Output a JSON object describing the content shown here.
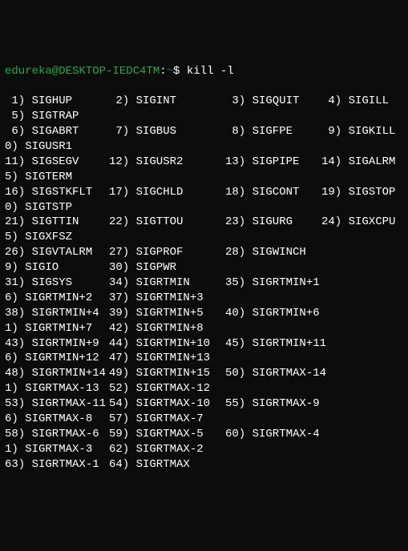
{
  "prompt": {
    "user_host": "edureka@DESKTOP-IEDC4TM",
    "path": "~",
    "cmd_symbol": "$ ",
    "command": "kill -l"
  },
  "signals": {
    "s1": {
      "n": " 1)",
      "name": "SIGHUP"
    },
    "s2": {
      "n": " 2)",
      "name": "SIGINT"
    },
    "s3": {
      "n": " 3)",
      "name": "SIGQUIT"
    },
    "s4": {
      "n": " 4)",
      "name": "SIGILL"
    },
    "s5": {
      "n": " 5)",
      "name": "SIGTRAP"
    },
    "s6": {
      "n": " 6)",
      "name": "SIGABRT"
    },
    "s7": {
      "n": " 7)",
      "name": "SIGBUS"
    },
    "s8": {
      "n": " 8)",
      "name": "SIGFPE"
    },
    "s9": {
      "n": " 9)",
      "name": "SIGKILL"
    },
    "s10": {
      "n": "0)",
      "name": "SIGUSR1"
    },
    "s11": {
      "n": "11)",
      "name": "SIGSEGV"
    },
    "s12": {
      "n": "12)",
      "name": "SIGUSR2"
    },
    "s13": {
      "n": "13)",
      "name": "SIGPIPE"
    },
    "s14": {
      "n": "14)",
      "name": "SIGALRM"
    },
    "s15": {
      "n": "5)",
      "name": "SIGTERM"
    },
    "s16": {
      "n": "16)",
      "name": "SIGSTKFLT"
    },
    "s17": {
      "n": "17)",
      "name": "SIGCHLD"
    },
    "s18": {
      "n": "18)",
      "name": "SIGCONT"
    },
    "s19": {
      "n": "19)",
      "name": "SIGSTOP"
    },
    "s20": {
      "n": "0)",
      "name": "SIGTSTP"
    },
    "s21": {
      "n": "21)",
      "name": "SIGTTIN"
    },
    "s22": {
      "n": "22)",
      "name": "SIGTTOU"
    },
    "s23": {
      "n": "23)",
      "name": "SIGURG"
    },
    "s24": {
      "n": "24)",
      "name": "SIGXCPU"
    },
    "s25": {
      "n": "5)",
      "name": "SIGXFSZ"
    },
    "s26": {
      "n": "26)",
      "name": "SIGVTALRM"
    },
    "s27": {
      "n": "27)",
      "name": "SIGPROF"
    },
    "s28": {
      "n": "28)",
      "name": "SIGWINCH"
    },
    "s29": {
      "n": "9)",
      "name": "SIGIO"
    },
    "s30": {
      "n": "30)",
      "name": "SIGPWR"
    },
    "s31": {
      "n": "31)",
      "name": "SIGSYS"
    },
    "s34": {
      "n": "34)",
      "name": "SIGRTMIN"
    },
    "s35": {
      "n": "35)",
      "name": "SIGRTMIN+1"
    },
    "s36": {
      "n": "6)",
      "name": "SIGRTMIN+2"
    },
    "s37": {
      "n": "37)",
      "name": "SIGRTMIN+3"
    },
    "s38": {
      "n": "38)",
      "name": "SIGRTMIN+4"
    },
    "s39": {
      "n": "39)",
      "name": "SIGRTMIN+5"
    },
    "s40": {
      "n": "40)",
      "name": "SIGRTMIN+6"
    },
    "s41": {
      "n": "1)",
      "name": "SIGRTMIN+7"
    },
    "s42": {
      "n": "42)",
      "name": "SIGRTMIN+8"
    },
    "s43": {
      "n": "43)",
      "name": "SIGRTMIN+9"
    },
    "s44": {
      "n": "44)",
      "name": "SIGRTMIN+10"
    },
    "s45": {
      "n": "45)",
      "name": "SIGRTMIN+11"
    },
    "s46": {
      "n": "6)",
      "name": "SIGRTMIN+12"
    },
    "s47": {
      "n": "47)",
      "name": "SIGRTMIN+13"
    },
    "s48": {
      "n": "48)",
      "name": "SIGRTMIN+14"
    },
    "s49": {
      "n": "49)",
      "name": "SIGRTMIN+15"
    },
    "s50": {
      "n": "50)",
      "name": "SIGRTMAX-14"
    },
    "s51": {
      "n": "1)",
      "name": "SIGRTMAX-13"
    },
    "s52": {
      "n": "52)",
      "name": "SIGRTMAX-12"
    },
    "s53": {
      "n": "53)",
      "name": "SIGRTMAX-11"
    },
    "s54": {
      "n": "54)",
      "name": "SIGRTMAX-10"
    },
    "s55": {
      "n": "55)",
      "name": "SIGRTMAX-9"
    },
    "s56": {
      "n": "6)",
      "name": "SIGRTMAX-8"
    },
    "s57": {
      "n": "57)",
      "name": "SIGRTMAX-7"
    },
    "s58": {
      "n": "58)",
      "name": "SIGRTMAX-6"
    },
    "s59": {
      "n": "59)",
      "name": "SIGRTMAX-5"
    },
    "s60": {
      "n": "60)",
      "name": "SIGRTMAX-4"
    },
    "s61": {
      "n": "1)",
      "name": "SIGRTMAX-3"
    },
    "s62": {
      "n": "62)",
      "name": "SIGRTMAX-2"
    },
    "s63": {
      "n": "63)",
      "name": "SIGRTMAX-1"
    },
    "s64": {
      "n": "64)",
      "name": "SIGRTMAX"
    }
  }
}
